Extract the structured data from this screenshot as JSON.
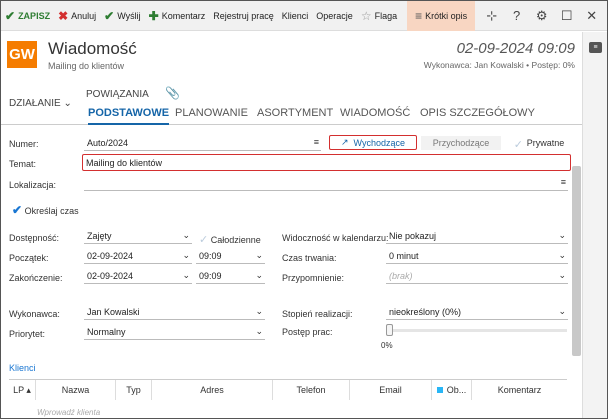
{
  "toolbar": {
    "save": "ZAPISZ",
    "cancel": "Anuluj",
    "send": "Wyślij",
    "comment": "Komentarz",
    "log_work": "Rejestruj pracę",
    "clients": "Klienci",
    "operations": "Operacje",
    "flag": "Flaga",
    "short_desc": "Krótki opis"
  },
  "header": {
    "badge": "GW",
    "title": "Wiadomość",
    "subtitle": "Mailing do klientów",
    "date": "02-09-2024 09:09",
    "meta": "Wykonawca: Jan Kowalski  •  Postęp: 0%"
  },
  "tabs": {
    "action": "DZIAŁANIE",
    "links": "POWIĄZANIA",
    "items": [
      "PODSTAWOWE",
      "PLANOWANIE",
      "ASORTYMENT",
      "WIADOMOŚĆ",
      "OPIS SZCZEGÓŁOWY"
    ]
  },
  "form": {
    "number_label": "Numer:",
    "number_value": "Auto/2024",
    "outgoing": "Wychodzące",
    "incoming": "Przychodzące",
    "private": "Prywatne",
    "subject_label": "Temat:",
    "subject_value": "Mailing do klientów",
    "location_label": "Lokalizacja:",
    "specify_time": "Określaj czas",
    "availability_label": "Dostępność:",
    "availability_value": "Zajęty",
    "all_day": "Całodzienne",
    "start_label": "Początek:",
    "start_date": "02-09-2024",
    "start_time": "09:09",
    "end_label": "Zakończenie:",
    "end_date": "02-09-2024",
    "end_time": "09:09",
    "calendar_label": "Widoczność w kalendarzu:",
    "calendar_value": "Nie pokazuj",
    "duration_label": "Czas trwania:",
    "duration_value": "0 minut",
    "reminder_label": "Przypomnienie:",
    "reminder_value": "(brak)",
    "executor_label": "Wykonawca:",
    "executor_value": "Jan Kowalski",
    "priority_label": "Priorytet:",
    "priority_value": "Normalny",
    "completion_label": "Stopień realizacji:",
    "completion_value": "nieokreślony  (0%)",
    "progress_label": "Postęp prac:",
    "progress_value": "0%",
    "progress_fraction": 0
  },
  "clients": {
    "section": "Klienci",
    "columns": [
      "LP ▴",
      "Nazwa",
      "Typ",
      "Adres",
      "Telefon",
      "Email",
      "Ob...",
      "Komentarz"
    ],
    "placeholder": "Wprowadź klienta"
  }
}
